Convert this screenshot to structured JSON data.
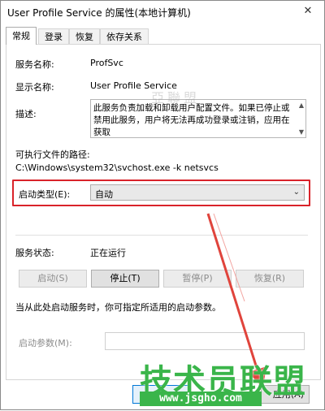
{
  "window": {
    "title": "User Profile Service 的属性(本地计算机)",
    "close_glyph": "✕"
  },
  "tabs": [
    "常规",
    "登录",
    "恢复",
    "依存关系"
  ],
  "general": {
    "service_name_label": "服务名称:",
    "service_name_value": "ProfSvc",
    "display_name_label": "显示名称:",
    "display_name_value": "User Profile Service",
    "description_label": "描述:",
    "description_value": "此服务负责加载和卸载用户配置文件。如果已停止或禁用此服务，用户将无法再成功登录或注销，应用在获取",
    "exe_path_label": "可执行文件的路径:",
    "exe_path_value": "C:\\Windows\\system32\\svchost.exe -k netsvcs",
    "startup_type_label": "启动类型(E):",
    "startup_type_value": "自动",
    "status_label": "服务状态:",
    "status_value": "正在运行",
    "buttons": {
      "start": "启动(S)",
      "stop": "停止(T)",
      "pause": "暂停(P)",
      "resume": "恢复(R)"
    },
    "hint": "当从此处启动服务时，你可指定所适用的启动参数。",
    "start_params_label": "启动参数(M):",
    "start_params_value": ""
  },
  "footer": {
    "apply_label": "应用(A)"
  },
  "watermark": {
    "logo_text": "技术员联盟",
    "url_text": "www.jsgho.com",
    "faint_text": "亞聯盟"
  },
  "colors": {
    "highlight": "#d9232a",
    "arrow": "#e0443c",
    "watermark_green": "#3ab54a",
    "focus_blue": "#0078d7"
  }
}
